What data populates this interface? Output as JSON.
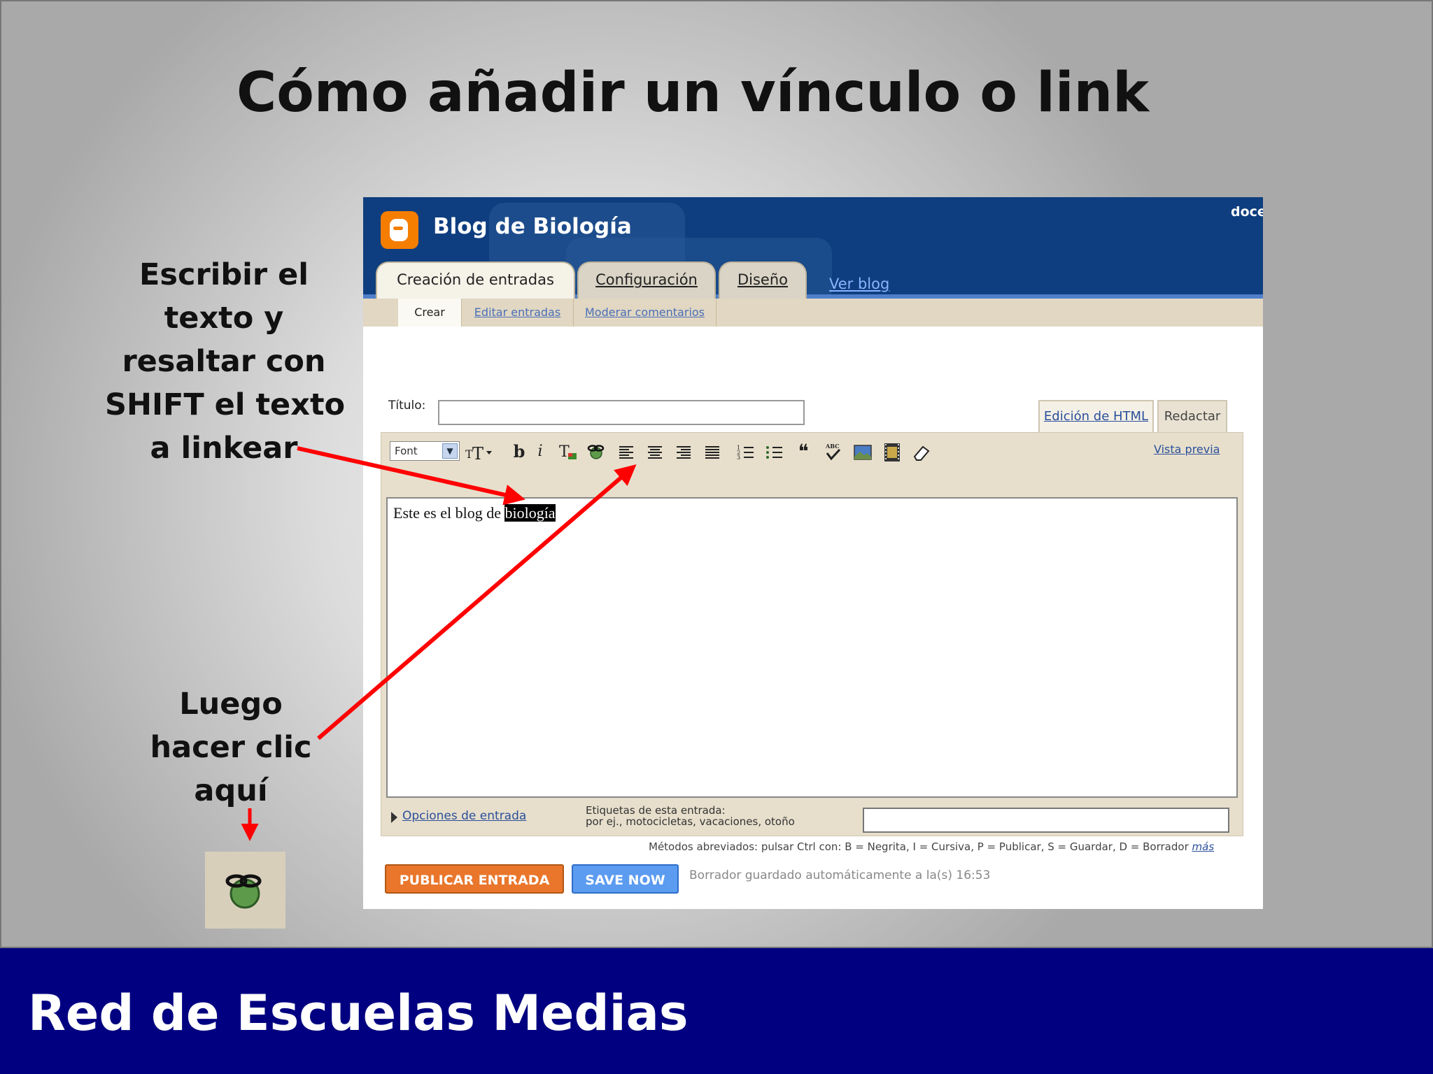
{
  "slide": {
    "title": "Cómo añadir un vínculo o link",
    "note_top": [
      "Escribir el",
      "texto y",
      "resaltar con",
      "SHIFT el texto",
      "a linkear"
    ],
    "note_bottom": [
      "Luego",
      "hacer clic",
      "aquí"
    ],
    "footer": "Red de Escuelas Medias"
  },
  "blogger": {
    "blog_title": "Blog de Biología",
    "user_partial": "doce",
    "tabs": [
      "Creación de entradas",
      "Configuración",
      "Diseño"
    ],
    "ver_blog": "Ver blog",
    "subtabs": [
      "Crear",
      "Editar entradas",
      "Moderar comentarios"
    ],
    "title_label": "Título:",
    "mode_tabs": [
      "Edición de HTML",
      "Redactar"
    ],
    "toolbar": {
      "font_select": "Font",
      "vista_previa": "Vista previa",
      "bold": "b",
      "italic": "i"
    },
    "editor": {
      "text_before": "Este es el blog de ",
      "text_selected": "biología"
    },
    "options_link": "Opciones de entrada",
    "tags_label": "Etiquetas de esta entrada:",
    "tags_hint": "por ej., motocicletas, vacaciones, otoño",
    "shortcuts": "Métodos abreviados: pulsar Ctrl con: B = Negrita, I = Cursiva, P = Publicar, S = Guardar, D = Borrador",
    "shortcuts_more": "más",
    "publish_button": "PUBLICAR ENTRADA",
    "save_button": "SAVE NOW",
    "autosave": "Borrador guardado automáticamente a la(s) 16:53"
  },
  "colors": {
    "footer_bg": "#000080",
    "arrow": "#ff0000",
    "header_bg": "#0e3e7f",
    "publish": "#e9762b",
    "save": "#5b9bf0"
  }
}
